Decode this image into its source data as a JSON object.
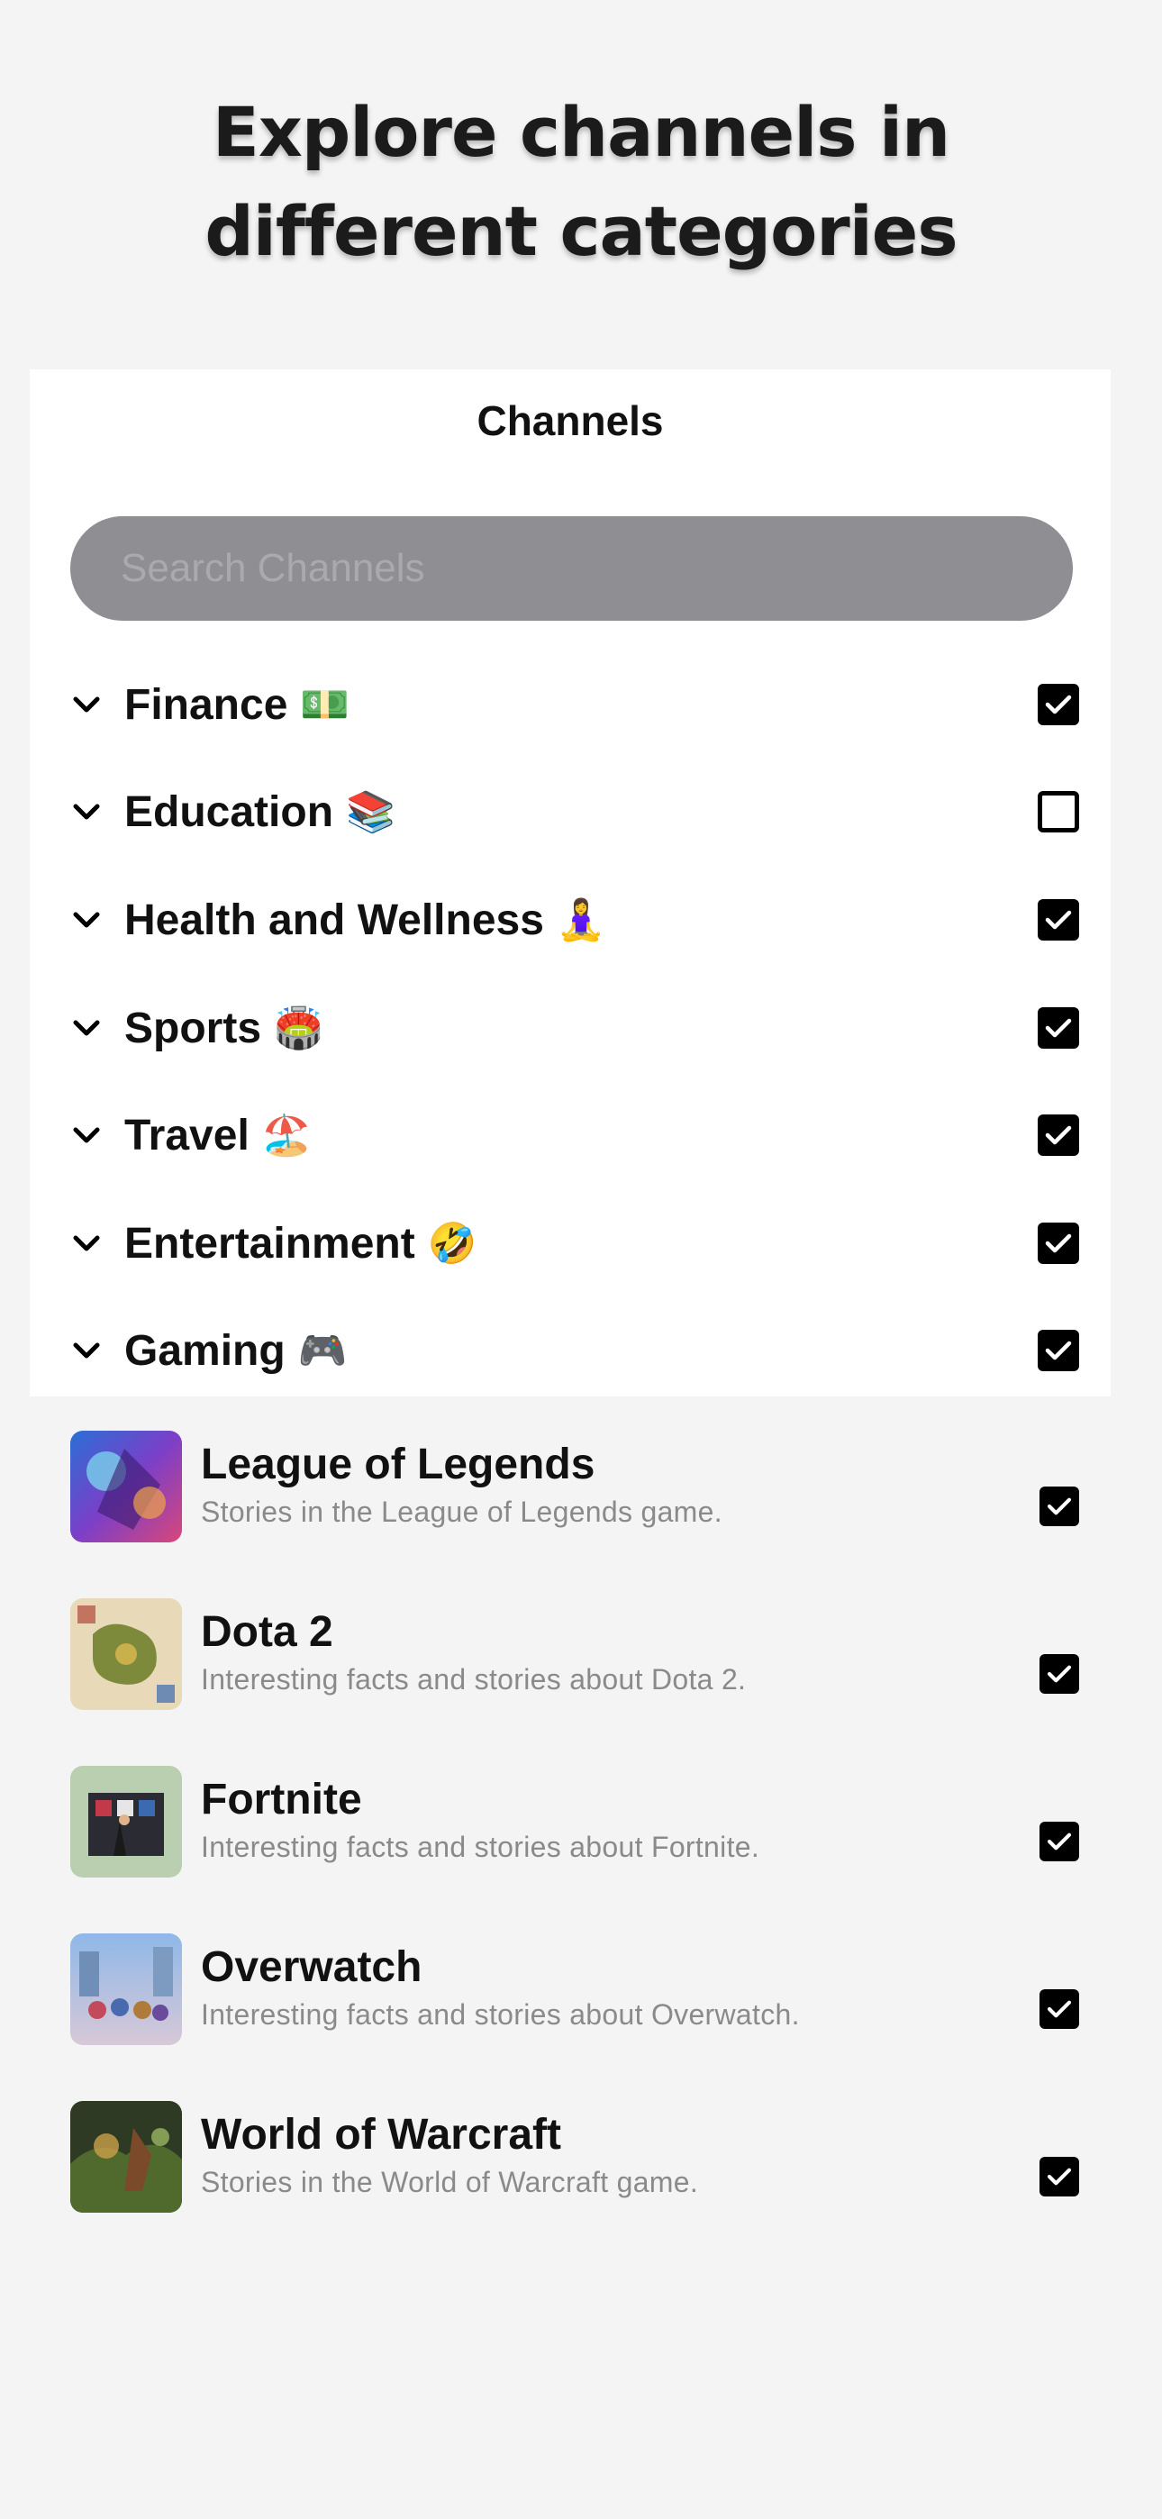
{
  "hero": {
    "title": "Explore channels in different categories"
  },
  "panel": {
    "title": "Channels",
    "search_placeholder": "Search Channels"
  },
  "categories": [
    {
      "label": "Finance",
      "emoji": "💵",
      "checked": true
    },
    {
      "label": "Education",
      "emoji": "📚",
      "checked": false
    },
    {
      "label": "Health and Wellness",
      "emoji": "🧘‍♀️",
      "checked": true
    },
    {
      "label": "Sports",
      "emoji": "🏟️",
      "checked": true
    },
    {
      "label": "Travel",
      "emoji": "🏖️",
      "checked": true
    },
    {
      "label": "Entertainment",
      "emoji": "🤣",
      "checked": true
    },
    {
      "label": "Gaming",
      "emoji": "🎮",
      "checked": true
    }
  ],
  "gaming_channels": [
    {
      "title": "League of Legends",
      "description": "Stories in the League of Legends game.",
      "checked": true
    },
    {
      "title": "Dota 2",
      "description": "Interesting facts and stories about Dota 2.",
      "checked": true
    },
    {
      "title": "Fortnite",
      "description": "Interesting facts and stories about Fortnite.",
      "checked": true
    },
    {
      "title": "Overwatch",
      "description": "Interesting facts and stories about Overwatch.",
      "checked": true
    },
    {
      "title": "World of Warcraft",
      "description": "Stories in the World of Warcraft game.",
      "checked": true
    }
  ],
  "icons": {
    "chevron": "chevron-down-icon",
    "check": "checkmark-icon"
  }
}
